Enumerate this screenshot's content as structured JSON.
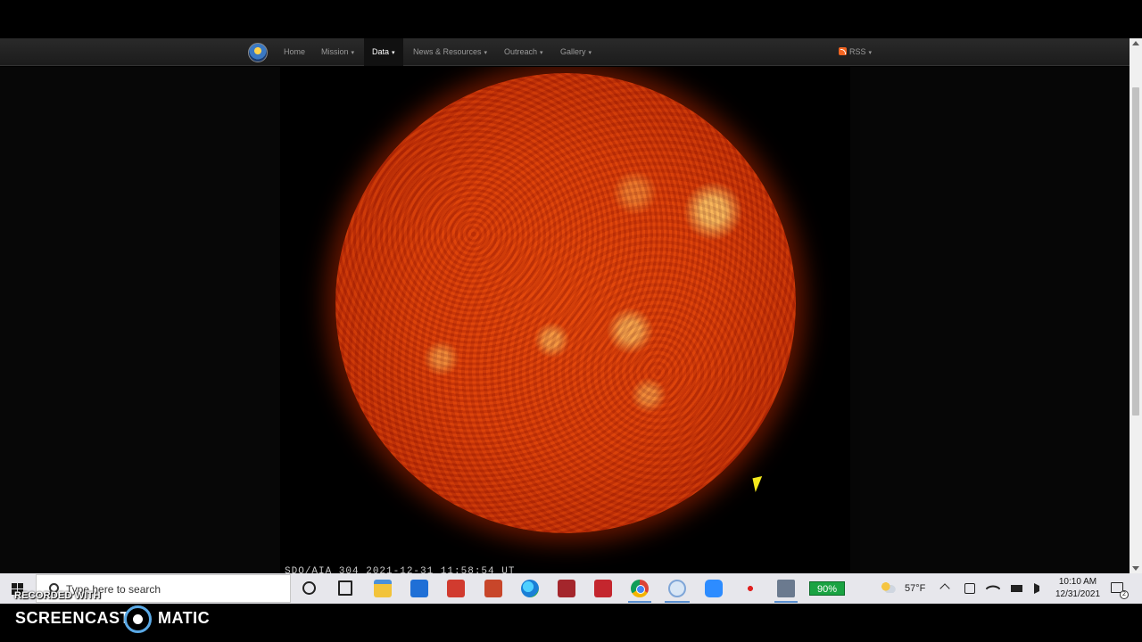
{
  "navbar": {
    "items": [
      {
        "label": "Home",
        "has_caret": false
      },
      {
        "label": "Mission",
        "has_caret": true
      },
      {
        "label": "Data",
        "has_caret": true,
        "active": true
      },
      {
        "label": "News & Resources",
        "has_caret": true
      },
      {
        "label": "Outreach",
        "has_caret": true
      },
      {
        "label": "Gallery",
        "has_caret": true
      }
    ],
    "caret": "▾",
    "rss_label": "RSS"
  },
  "image": {
    "caption": "SDO/AIA  304    2021-12-31 11:58:54 UT"
  },
  "taskbar": {
    "search_placeholder": "Type here to search",
    "battery_percent": "90%",
    "weather_temp": "57°F",
    "clock_time": "10:10 AM",
    "clock_date": "12/31/2021",
    "notification_count": "2",
    "apps": [
      "cortana-icon",
      "task-view-icon",
      "file-explorer-icon",
      "store-icon",
      "reader-icon",
      "powerpoint-icon",
      "edge-icon",
      "access-icon",
      "stylus-icon",
      "chrome-icon",
      "screencast-icon",
      "zoom-icon",
      "record-icon",
      "network-app-icon"
    ]
  },
  "watermark": {
    "recorded_with": "RECORDED WITH",
    "brand_left": "SCREENCAST",
    "brand_right": "MATIC"
  },
  "colors": {
    "sun_core": "#e0420a",
    "sun_limb": "#7a1200",
    "battery_green": "#1aa342",
    "nav_bg": "#1c1c1c"
  }
}
